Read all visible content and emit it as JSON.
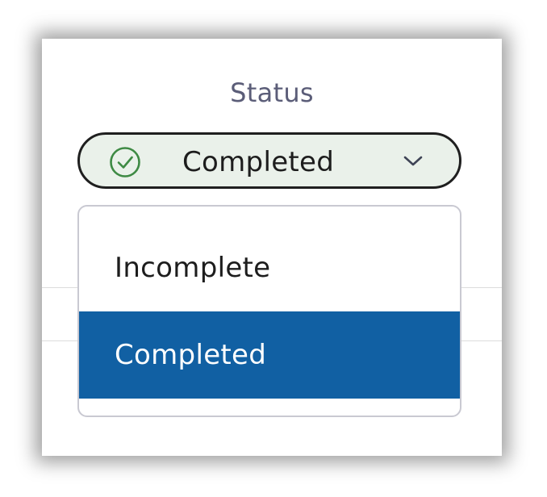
{
  "column": {
    "header": "Status"
  },
  "select": {
    "value": "Completed",
    "icon": "check-circle-icon",
    "accent_color": "#3e8a44",
    "background_color": "#eaf1ea"
  },
  "dropdown": {
    "options": [
      {
        "label": "Incomplete",
        "selected": false
      },
      {
        "label": "Completed",
        "selected": true
      }
    ],
    "selected_color": "#1160a3"
  }
}
